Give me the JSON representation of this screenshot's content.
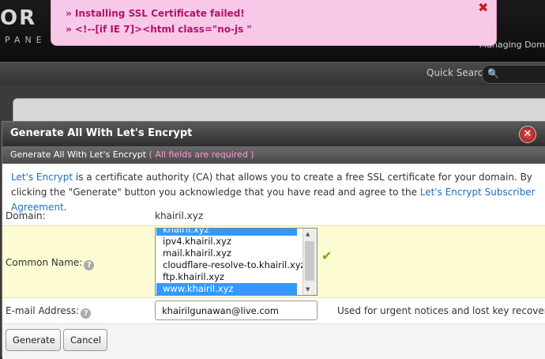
{
  "notification": {
    "line1": "» Installing SSL Certificate failed!",
    "line2": "» <!--[if IE 7]><html class=\"no-js \"",
    "close_icon": "x-icon"
  },
  "app": {
    "logo_text": "OR",
    "logo_sub": "PANE",
    "managing_text": "Managing Dom",
    "quick_search_label": "Quick Search",
    "search_icon": "magnifier-icon"
  },
  "dialog": {
    "title": "Generate All With Let's Encrypt",
    "subheader": "Generate All With Let's Encrypt",
    "subheader_required": "( All fields are required )",
    "intro": {
      "link1": "Let's Encrypt",
      "text1": " is a certificate authority (CA) that allows you to create a free SSL certificate for your domain. By clicking the \"Generate\" button you acknowledge that you have read and agree to the ",
      "link2": "Let's Encrypt Subscriber Agreement",
      "text2": "."
    },
    "domain": {
      "label": "Domain:",
      "value": "khairil.xyz"
    },
    "common_name": {
      "label": "Common Name:",
      "help_icon": "question-icon",
      "options": [
        {
          "text": "khairil.xyz",
          "selected": true
        },
        {
          "text": "ipv4.khairil.xyz",
          "selected": false
        },
        {
          "text": "mail.khairil.xyz",
          "selected": false
        },
        {
          "text": "cloudflare-resolve-to.khairil.xyz",
          "selected": false
        },
        {
          "text": "ftp.khairil.xyz",
          "selected": false
        },
        {
          "text": "www.khairil.xyz",
          "selected": true
        }
      ],
      "valid_icon": "checkmark-icon"
    },
    "email": {
      "label": "E-mail Address:",
      "value": "khairilgunawan@live.com",
      "note": "Used for urgent notices and lost key recovery."
    },
    "buttons": {
      "generate": "Generate",
      "cancel": "Cancel"
    }
  }
}
